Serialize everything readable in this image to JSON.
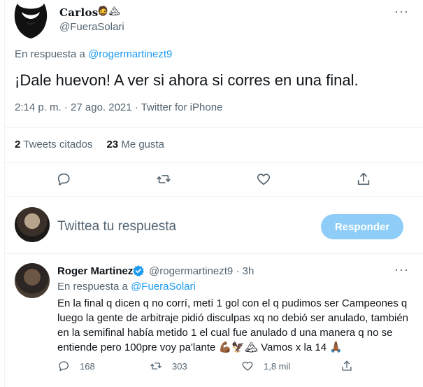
{
  "tweet": {
    "display_name": "Carlos",
    "name_emojis": "🧔🏔",
    "handle": "@FueraSolari",
    "reply_prefix": "En respuesta a",
    "reply_to": "@rogermartinezt9",
    "text": "¡Dale huevon! A ver si ahora si corres en una final.",
    "timestamp": "2:14 p. m. · 27 ago. 2021 · Twitter for iPhone",
    "more_icon": "···",
    "stats": {
      "quotes_count": "2",
      "quotes_label": "Tweets citados",
      "likes_count": "23",
      "likes_label": "Me gusta"
    },
    "actions": [
      "reply-icon",
      "retweet-icon",
      "like-icon",
      "share-icon"
    ]
  },
  "compose": {
    "placeholder": "Twittea tu respuesta",
    "reply_button": "Responder"
  },
  "reply": {
    "display_name": "Roger Martinez",
    "handle_time": "@rogermartinezt9 · 3h",
    "reply_prefix": "En respuesta a",
    "reply_to": "@FueraSolari",
    "text": "En la final q dicen q no corrí, metí 1 gol con el q pudimos ser Campeones q luego la gente de arbitraje pidió disculpas xq no debió ser anulado, también en la semifinal había metido 1 el cual fue anulado d una manera q no se entiende pero 100pre voy pa'lante 💪🏾🦅🏔 Vamos x la 14 🙏🏾",
    "more_icon": "···",
    "replies": "168",
    "retweets": "303",
    "likes": "1,8 mil"
  },
  "colors": {
    "accent": "#1d9bf0",
    "muted": "#536471",
    "button_disabled": "#8ecdf8"
  }
}
